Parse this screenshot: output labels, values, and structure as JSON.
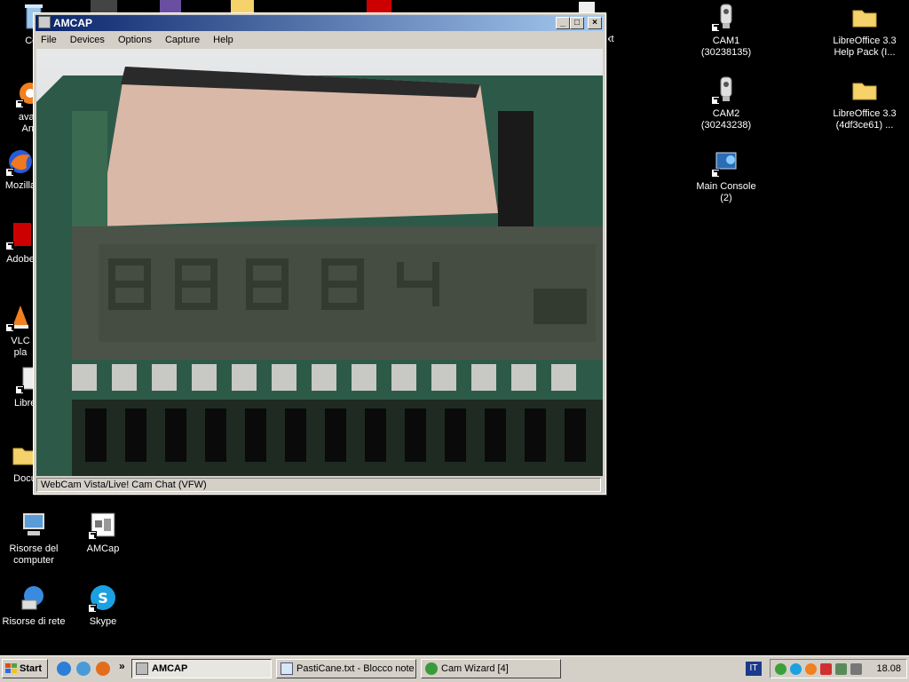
{
  "window": {
    "title": "AMCAP",
    "menu": [
      "File",
      "Devices",
      "Options",
      "Capture",
      "Help"
    ],
    "status": "WebCam Vista/Live! Cam Chat (VFW)",
    "controls": {
      "minimize": "_",
      "maximize": "□",
      "close": "×"
    }
  },
  "desktop_icons_left": [
    {
      "label": "Ces",
      "icon": "recycle-bin-icon"
    },
    {
      "label": "avast\nAnti",
      "icon": "avast-icon"
    },
    {
      "label": "Mozilla",
      "icon": "firefox-icon"
    },
    {
      "label": "Adobe",
      "icon": "adobe-reader-icon"
    },
    {
      "label": "VLC\npla",
      "icon": "vlc-icon"
    },
    {
      "label": "LibreOf",
      "icon": "libreoffice-icon"
    },
    {
      "label": "Docu",
      "icon": "folder-icon"
    },
    {
      "label": "Risorse del\ncomputer",
      "icon": "my-computer-icon"
    },
    {
      "label": "Risorse di rete",
      "icon": "network-icon"
    }
  ],
  "desktop_icons_col2": [
    {
      "label": "AMCap",
      "icon": "amcap-icon"
    },
    {
      "label": "Skype",
      "icon": "skype-icon"
    }
  ],
  "desktop_icons_right": [
    {
      "label": "CAM1\n(30238135)",
      "icon": "camera-icon"
    },
    {
      "label": "CAM2\n(30243238)",
      "icon": "camera-icon"
    },
    {
      "label": "Main Console\n(2)",
      "icon": "console-icon"
    },
    {
      "label": "LibreOffice 3.3\nHelp Pack (I...",
      "icon": "folder-icon"
    },
    {
      "label": "LibreOffice 3.3\n(4df3ce61) ...",
      "icon": "folder-icon"
    }
  ],
  "partial_label_xt": "xt",
  "taskbar": {
    "start": "Start",
    "tasks": [
      {
        "label": "AMCAP",
        "active": true
      },
      {
        "label": "PastiCane.txt - Blocco note",
        "active": false
      },
      {
        "label": "Cam Wizard [4]",
        "active": false
      }
    ],
    "language": "IT",
    "clock": "18.08"
  }
}
